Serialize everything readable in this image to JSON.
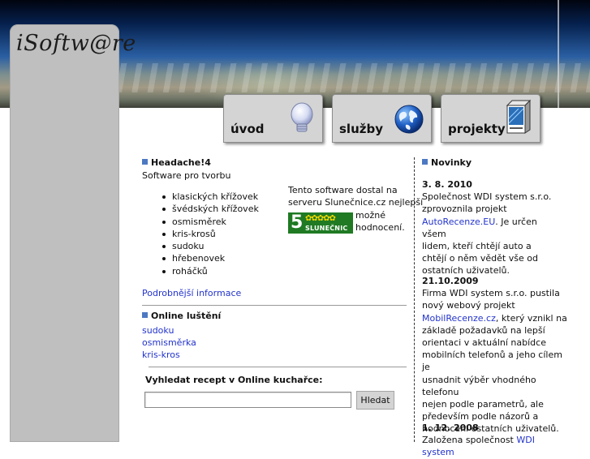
{
  "site": {
    "logo_text": "iSoftw@re"
  },
  "nav": {
    "tabs": [
      {
        "label": "úvod",
        "icon": "lightbulb-icon"
      },
      {
        "label": "služby",
        "icon": "globe-icon"
      },
      {
        "label": "projekty",
        "icon": "software-box-icon"
      }
    ]
  },
  "main": {
    "headache": {
      "heading": "Headache!4",
      "intro": "Software pro tvorbu",
      "items": [
        "klasických křížovek",
        "švédských křížovek",
        "osmisměrek",
        "kris-krosů",
        "sudoku",
        "hřebenovek",
        "roháčků"
      ],
      "more_link": "Podrobnější informace"
    },
    "award": {
      "line1": "Tento software dostal na",
      "line2": "serveru Slunečnice.cz nejlepší",
      "badge_number": "5",
      "badge_stars": "✿✿✿✿✿",
      "badge_label": "SLUNEČNIC",
      "line3": "možné",
      "line4": "hodnocení."
    },
    "online": {
      "heading": "Online luštění",
      "links": [
        "sudoku",
        "osmisměrka",
        "kris-kros"
      ]
    },
    "recipe_search": {
      "label": "Vyhledat recept v Online kuchařce:",
      "input_value": "",
      "button_label": "Hledat"
    }
  },
  "news": {
    "heading": "Novinky",
    "items": [
      {
        "date": "3. 8. 2010",
        "lines": [
          "Společnost WDI system s.r.o.",
          "zprovoznila projekt"
        ],
        "link": "AutoRecenze.EU",
        "after_link": ". Je určen všem",
        "rest": [
          "lidem, kteří chtějí auto a",
          "chtějí o něm vědět vše od",
          "ostatních uživatelů."
        ]
      },
      {
        "date": "21.10.2009",
        "lines": [
          "Firma WDI system s.r.o. pustila",
          "nový webový projekt"
        ],
        "link": "MobilRecenze.cz",
        "after_link": ", který vznikl na",
        "rest": [
          "základě požadavků na lepší",
          "orientaci v aktuální nabídce",
          "mobilních telefonů a jeho cílem je",
          "usnadnit výběr vhodného telefonu",
          "nejen podle parametrů, ale",
          "především podle názorů a",
          "hodnocení ostatních uživatelů."
        ]
      },
      {
        "date": "1. 12. 2008",
        "lead": "Založena společnost ",
        "link": "WDI system"
      }
    ]
  },
  "colors": {
    "accent_square": "#4d79c2",
    "link": "#2233cc",
    "sidebar": "#bfbfbf",
    "tab_bg": "#d4d4d4"
  }
}
